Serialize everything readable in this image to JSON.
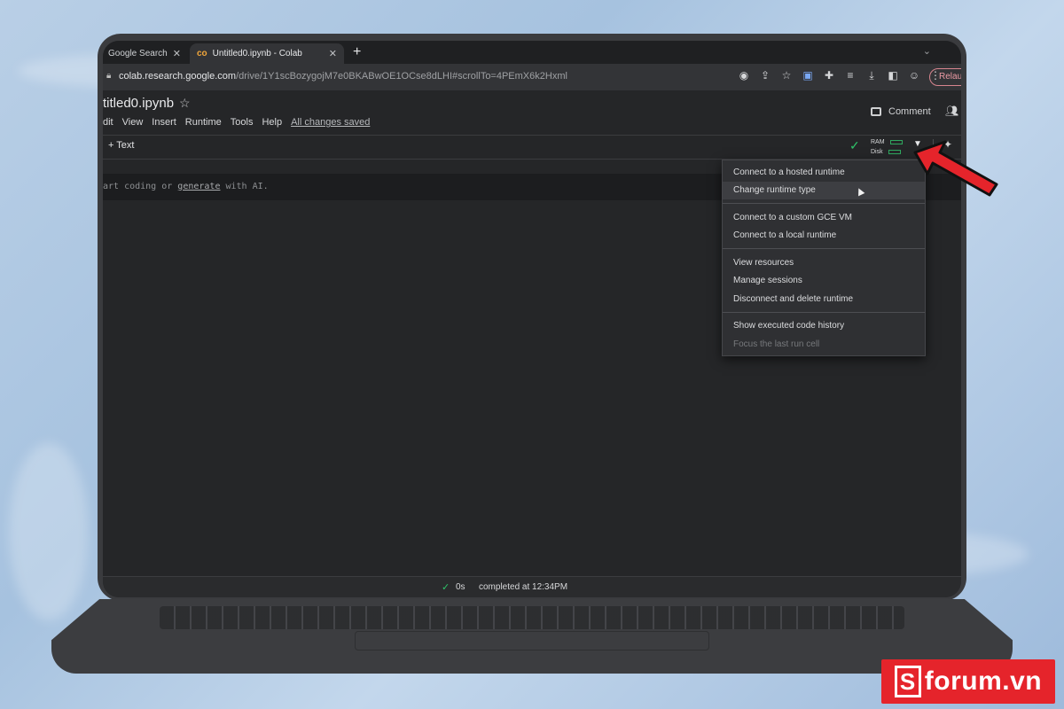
{
  "browser": {
    "tabs": [
      {
        "label": "Google Search",
        "close": "✕"
      },
      {
        "label": "Untitled0.ipynb - Colab",
        "close": "✕",
        "favicon": "co"
      }
    ],
    "new_tab": "+",
    "url_host": "colab.research.google.com",
    "url_path": "/drive/1Y1scBozygojM7e0BKABwOE1OCse8dLHI#scrollTo=4PEmX6k2Hxml",
    "relaunch_label": "Relaun"
  },
  "notebook": {
    "title": "titled0.ipynb",
    "menu": [
      "dit",
      "View",
      "Insert",
      "Runtime",
      "Tools",
      "Help"
    ],
    "saved_status": "All changes saved",
    "comment_label": "Comment",
    "add_text_label": "+ Text",
    "ram_label": "RAM",
    "disk_label": "Disk",
    "cell_placeholder_prefix": "art coding or ",
    "cell_placeholder_link": "generate",
    "cell_placeholder_suffix": " with AI."
  },
  "runtime_menu": {
    "items": [
      "Connect to a hosted runtime",
      "Change runtime type",
      "Connect to a custom GCE VM",
      "Connect to a local runtime",
      "View resources",
      "Manage sessions",
      "Disconnect and delete runtime",
      "Show executed code history",
      "Focus the last run cell"
    ]
  },
  "status": {
    "duration": "0s",
    "text": "completed at 12:34PM"
  },
  "watermark": {
    "logo_letter": "S",
    "text": "forum.vn"
  },
  "colors": {
    "accent_green": "#2fc46a",
    "arrow_red": "#e5242b",
    "brand_red": "#e5242b"
  }
}
